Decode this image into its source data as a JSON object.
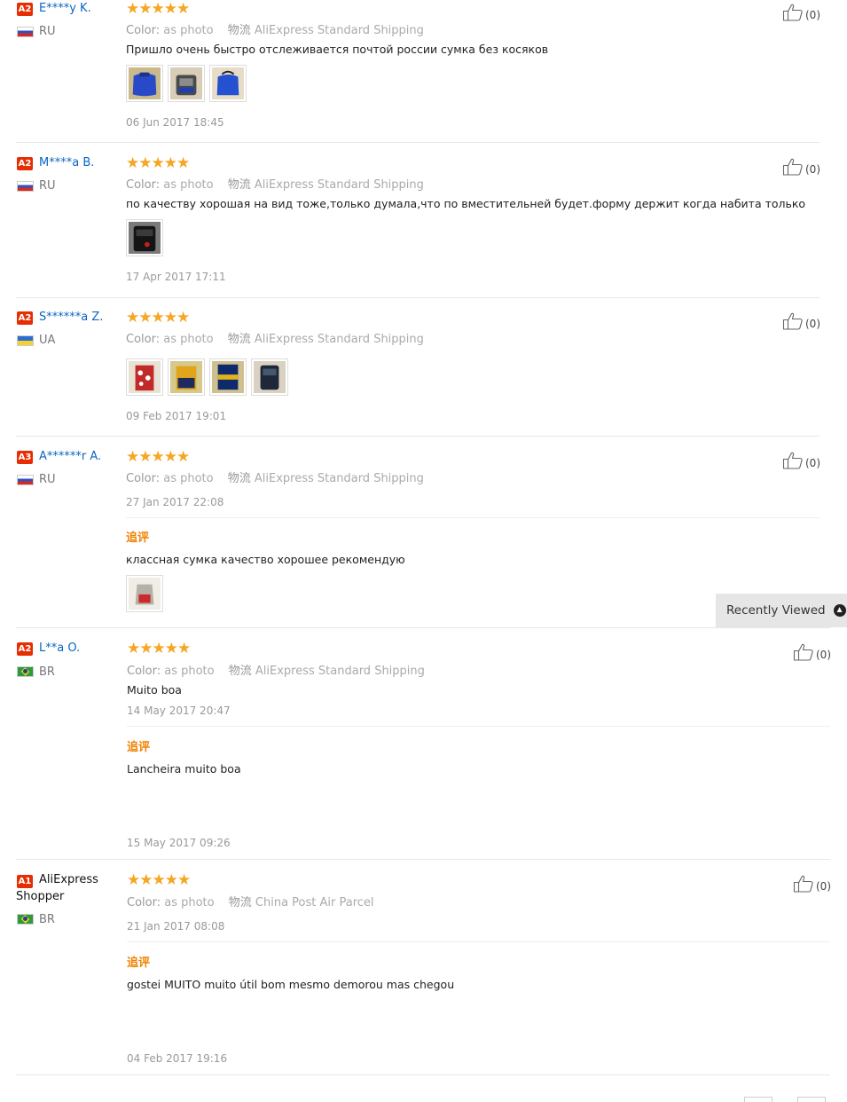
{
  "reviews": [
    {
      "badge": "A2",
      "name": "E****y K.",
      "country": "RU",
      "stars": "★★★★★",
      "color_label": "Color:",
      "color_value": "as photo",
      "shipping_label": "物流",
      "shipping_value": "AliExpress Standard Shipping",
      "text": "Пришло очень быстро отслеживается почтой россии сумка без косяков",
      "date": "06 Jun 2017 18:45",
      "likes": "(0)"
    },
    {
      "badge": "A2",
      "name": "M****a B.",
      "country": "RU",
      "stars": "★★★★★",
      "color_label": "Color:",
      "color_value": "as photo",
      "shipping_label": "物流",
      "shipping_value": "AliExpress Standard Shipping",
      "text": "по качеству хорошая на вид тоже,только думала,что по вместительней будет.форму держит когда набита только",
      "date": "17 Apr 2017 17:11",
      "likes": "(0)"
    },
    {
      "badge": "A2",
      "name": "S******a Z.",
      "country": "UA",
      "stars": "★★★★★",
      "color_label": "Color:",
      "color_value": "as photo",
      "shipping_label": "物流",
      "shipping_value": "AliExpress Standard Shipping",
      "date": "09 Feb 2017 19:01",
      "likes": "(0)"
    },
    {
      "badge": "A3",
      "name": "A******r A.",
      "country": "RU",
      "stars": "★★★★★",
      "color_label": "Color:",
      "color_value": "as photo",
      "shipping_label": "物流",
      "shipping_value": "AliExpress Standard Shipping",
      "date": "27 Jan 2017 22:08",
      "additional_label": "追评",
      "additional_text": "классная сумка качество хорошее рекомендую",
      "likes": "(0)"
    },
    {
      "badge": "A2",
      "name": "L**a O.",
      "country": "BR",
      "stars": "★★★★★",
      "color_label": "Color:",
      "color_value": "as photo",
      "shipping_label": "物流",
      "shipping_value": "AliExpress Standard Shipping",
      "text": "Muito boa",
      "date": "14 May 2017 20:47",
      "additional_label": "追评",
      "additional_text": "Lancheira muito boa",
      "additional_date": "15 May 2017 09:26",
      "likes": "(0)"
    },
    {
      "badge": "A1",
      "name_line1": "AliExpress",
      "name_line2": "Shopper",
      "country": "BR",
      "stars": "★★★★★",
      "color_label": "Color:",
      "color_value": "as photo",
      "shipping_label": "物流",
      "shipping_value": "China Post Air Parcel",
      "date": "21 Jan 2017 08:08",
      "additional_label": "追评",
      "additional_text": "gostei MUITO muito útil bom mesmo demorou mas chegou",
      "additional_date": "04 Feb 2017 19:16",
      "likes": "(0)"
    }
  ],
  "recently_viewed": {
    "label": "Recently Viewed",
    "icon": "chevron-up-circle-icon"
  },
  "colors": {
    "accent_orange": "#f08200",
    "star": "#f5a623",
    "badge_red": "#e62e04",
    "link_blue": "#0a66c2"
  }
}
